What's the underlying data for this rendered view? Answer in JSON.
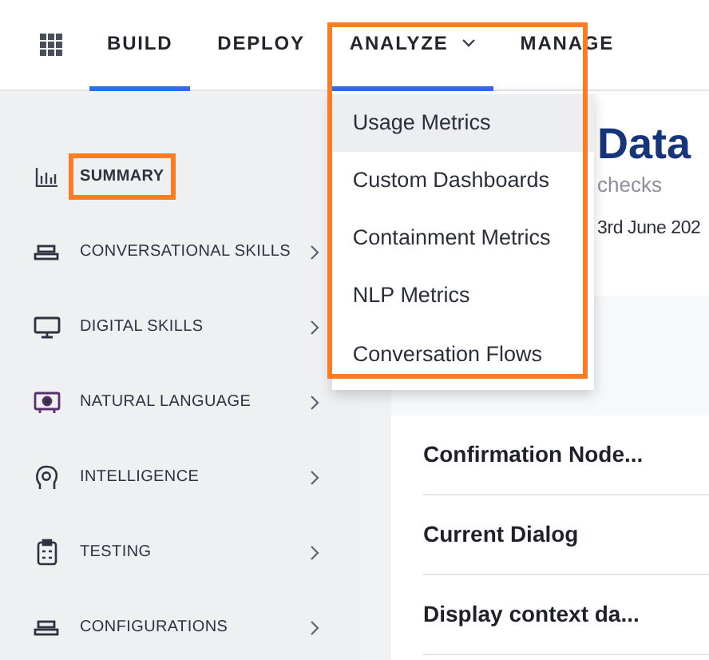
{
  "nav": {
    "tabs": [
      {
        "label": "BUILD",
        "kind": "link",
        "selected": true,
        "highlighted": false
      },
      {
        "label": "DEPLOY",
        "kind": "link",
        "selected": false,
        "highlighted": false
      },
      {
        "label": "ANALYZE",
        "kind": "menu",
        "selected": true,
        "highlighted": true
      },
      {
        "label": "MANAGE",
        "kind": "link",
        "selected": false,
        "highlighted": false
      }
    ]
  },
  "analyze_menu": {
    "open": true,
    "items": [
      {
        "label": "Usage Metrics",
        "hovered": true
      },
      {
        "label": "Custom Dashboards",
        "hovered": false
      },
      {
        "label": "Containment Metrics",
        "hovered": false
      },
      {
        "label": "NLP Metrics",
        "hovered": false
      },
      {
        "label": "Conversation Flows",
        "hovered": false
      }
    ]
  },
  "sidebar": {
    "items": [
      {
        "label": "SUMMARY",
        "kind": "page",
        "highlighted": true
      },
      {
        "label": "CONVERSATIONAL SKILLS",
        "kind": "group",
        "highlighted": false
      },
      {
        "label": "DIGITAL SKILLS",
        "kind": "group",
        "highlighted": false
      },
      {
        "label": "NATURAL LANGUAGE",
        "kind": "group",
        "highlighted": false
      },
      {
        "label": "INTELLIGENCE",
        "kind": "group",
        "highlighted": false
      },
      {
        "label": "TESTING",
        "kind": "group",
        "highlighted": false
      },
      {
        "label": "CONFIGURATIONS",
        "kind": "group",
        "highlighted": false
      }
    ]
  },
  "page_header": {
    "title": "Data",
    "subtitle": "checks",
    "date": "3rd June 202"
  },
  "rows": [
    {
      "label": "Confirmation Node..."
    },
    {
      "label": "Current Dialog"
    },
    {
      "label": "Display context da..."
    }
  ]
}
